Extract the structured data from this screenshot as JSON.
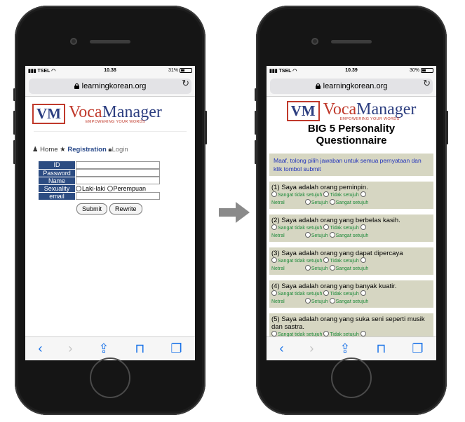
{
  "left_phone": {
    "status": {
      "carrier": "TSEL",
      "time": "10.38",
      "battery": "31%",
      "battery_level": 0.31
    },
    "url": "learningkorean.org",
    "logo": {
      "mark": "VM",
      "brand_a": "Voca",
      "brand_b": "Manager",
      "tagline": "EMPOWERING YOUR WORDS"
    },
    "nav": {
      "home": "Home",
      "registration": "Registration",
      "login": "Login"
    },
    "form": {
      "id_label": "ID",
      "password_label": "Password",
      "name_label": "Name",
      "sexuality_label": "Sexuality",
      "email_label": "email",
      "option_male": "Laki-laki",
      "option_female": "Perempuan",
      "submit_label": "Submit",
      "rewrite_label": "Rewrite"
    }
  },
  "right_phone": {
    "status": {
      "carrier": "TSEL",
      "time": "10.39",
      "battery": "30%",
      "battery_level": 0.3
    },
    "url": "learningkorean.org",
    "logo": {
      "mark": "VM",
      "brand_a": "Voca",
      "brand_b": "Manager",
      "tagline": "EMPOWERING YOUR WORDS"
    },
    "title_line1": "BIG 5 Personality",
    "title_line2": "Questionnaire",
    "notice": "Maaf, tolong pilih jawaban untuk semua pernyataan dan klik tombol submit",
    "options": {
      "o1": "Sangat tidak setujuh",
      "o2": "Tidak setujuh",
      "o3": "Netral",
      "o4": "Setujuh",
      "o5": "Sangat setujuh"
    },
    "questions": [
      "(1) Saya adalah orang peminpin.",
      "(2) Saya adalah orang yang berbelas kasih.",
      "(3) Saya adalah orang yang dapat dipercaya",
      "(4) Saya adalah orang yang banyak kuatir.",
      "(5) Saya adalah orang yang suka seni seperti musik dan sastra."
    ]
  },
  "icons": [
    "back-icon",
    "forward-icon",
    "share-icon",
    "bookmarks-icon",
    "tabs-icon",
    "lock-icon",
    "reload-icon",
    "wifi-icon",
    "arrow-right-icon"
  ],
  "colors": {
    "form_label_bg": "#2c4c82",
    "question_bg": "#d6d6c2",
    "notice_text": "#2233bb",
    "options_text": "#1e8a3a"
  }
}
